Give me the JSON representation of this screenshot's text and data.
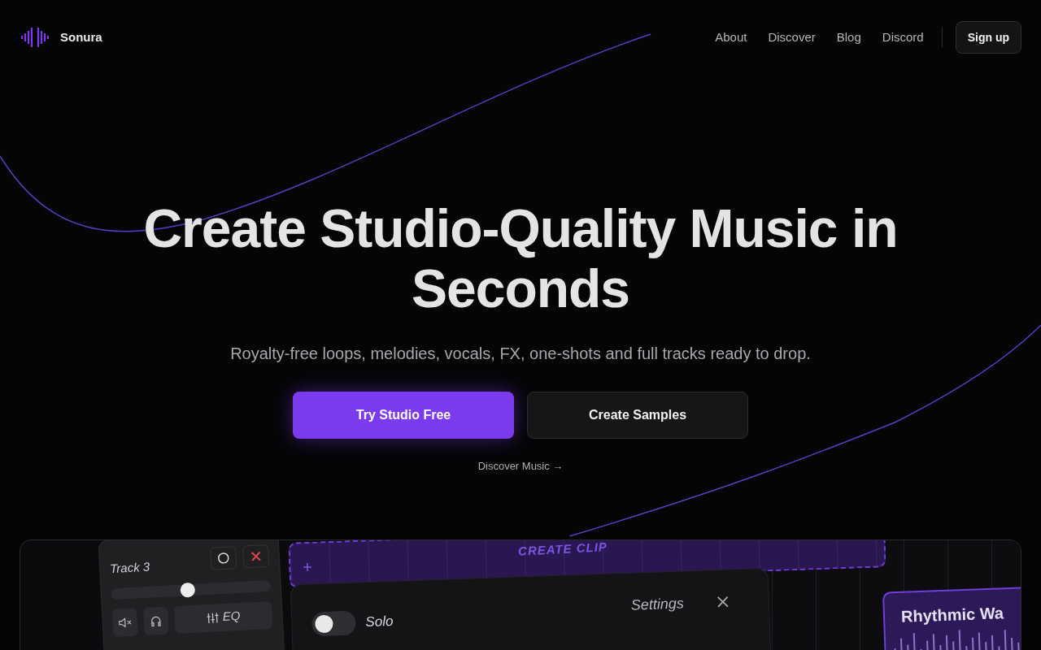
{
  "nav": {
    "brand": "Sonura",
    "links": [
      "About",
      "Discover",
      "Blog",
      "Discord"
    ],
    "signup": "Sign up"
  },
  "hero": {
    "title": "Create Studio-Quality Music in Seconds",
    "subtitle": "Royalty-free loops, melodies, vocals, FX, one-shots and full tracks ready to drop.",
    "buttons": [
      {
        "label": "Try Studio Free",
        "kind": "primary"
      },
      {
        "label": "Create Samples",
        "kind": "secondary"
      }
    ],
    "link": "Discover Music →"
  },
  "preview": {
    "track": {
      "name": "Track 3",
      "volume": {
        "level": 0.48
      },
      "eq_label": "EQ"
    },
    "clip_label": "CREATE CLIP",
    "settings": {
      "title": "Settings",
      "toggles": [
        {
          "label": "Solo",
          "on": false
        }
      ]
    },
    "clip_card": {
      "title": "Rhythmic Wa"
    }
  }
}
